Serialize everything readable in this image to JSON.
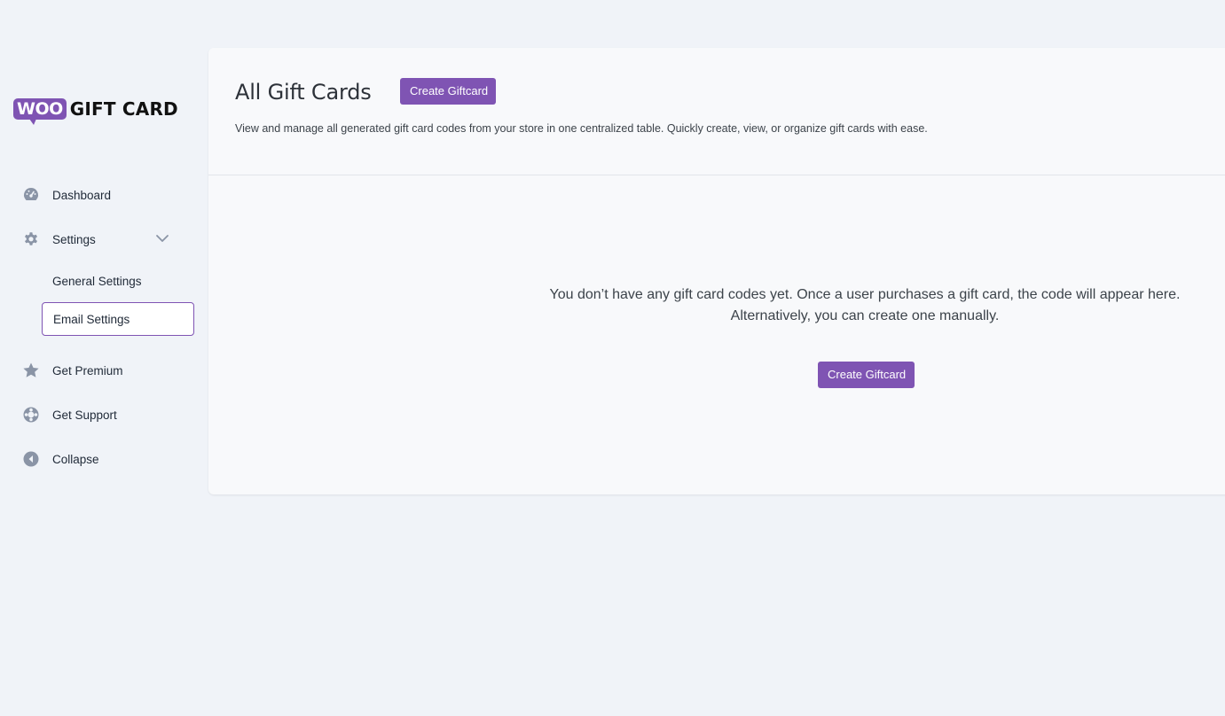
{
  "brand": {
    "badge": "WOO",
    "name": "GIFT CARD"
  },
  "sidebar": {
    "items": [
      {
        "label": "Dashboard",
        "icon": "dashboard-icon"
      },
      {
        "label": "Settings",
        "icon": "gear-icon"
      },
      {
        "label": "Get Premium",
        "icon": "star-icon"
      },
      {
        "label": "Get Support",
        "icon": "support-icon"
      },
      {
        "label": "Collapse",
        "icon": "collapse-icon"
      }
    ],
    "subitems": [
      {
        "label": "General Settings",
        "active": false
      },
      {
        "label": "Email Settings",
        "active": true
      }
    ]
  },
  "main": {
    "title": "All Gift Cards",
    "create_button": "Create Giftcard",
    "description": "View and manage all generated gift card codes from your store in one centralized table. Quickly create, view, or organize gift cards with ease.",
    "empty_line_1": "You don’t have any gift card codes yet. Once a user purchases a gift card, the code will appear here.",
    "empty_line_2": "Alternatively, you can create one manually.",
    "empty_button": "Create Giftcard"
  },
  "colors": {
    "accent": "#7f54b3",
    "icon": "#8a94a6",
    "background": "#f0f3f8",
    "card": "#f8f9fb"
  }
}
